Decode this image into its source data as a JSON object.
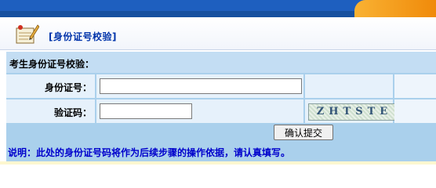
{
  "header": {
    "title": "[身份证号校验]",
    "icon": "notepad-pencil-icon"
  },
  "form": {
    "section_title": "考生身份证号校验：",
    "id_label": "身份证号：",
    "id_value": "",
    "code_label": "验证码：",
    "code_value": "",
    "captcha_text": "ZHTSTE",
    "submit_label": "确认提交",
    "note": "说明：此处的身份证号码将作为后续步骤的操作依据，请认真填写。"
  },
  "colors": {
    "topbar": "#1e5fbf",
    "tab_accent": "#f5a020",
    "panel": "#aad0ec",
    "cell": "#e6f1fb",
    "note_text": "#0000cc",
    "title_text": "#0033aa"
  }
}
